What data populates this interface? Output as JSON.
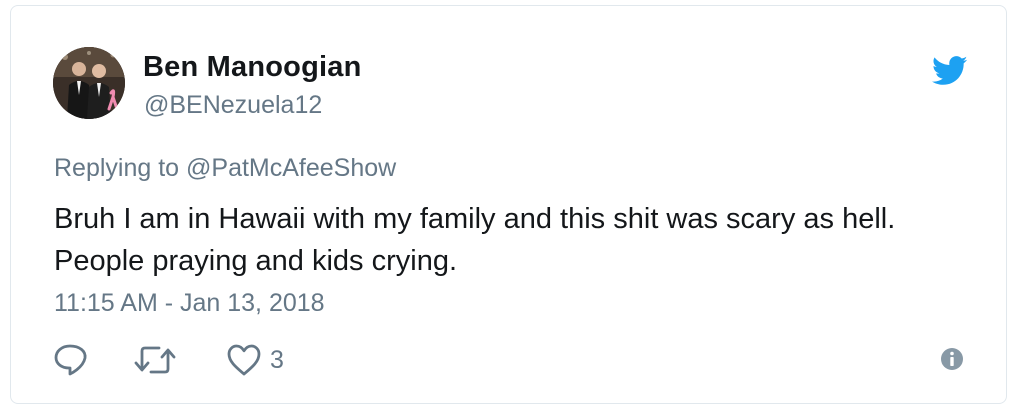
{
  "author": {
    "display_name": "Ben Manoogian",
    "handle": "@BENezuela12",
    "avatar_icon": "profile-photo"
  },
  "reply_context": {
    "label": "Replying to @PatMcAfeeShow"
  },
  "tweet": {
    "text": "Bruh I am in Hawaii with my family and this shit was scary as hell. People praying and kids crying.",
    "timestamp": "11:15 AM - Jan 13, 2018"
  },
  "actions": {
    "reply_icon": "speech-bubble-icon",
    "retweet_icon": "retweet-icon",
    "like_icon": "heart-icon",
    "like_count": "3",
    "info_icon": "info-icon"
  },
  "colors": {
    "twitter_blue": "#1da1f2",
    "secondary_text": "#657786",
    "primary_text": "#14171a",
    "border": "#e1e8ed"
  }
}
